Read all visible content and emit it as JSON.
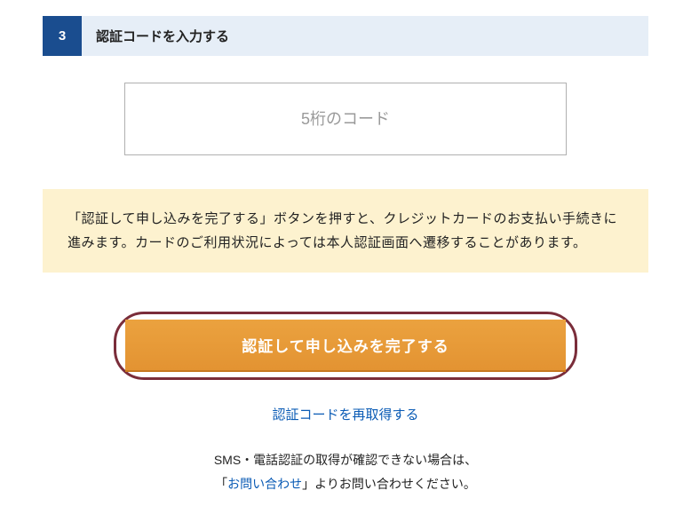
{
  "step": {
    "number": "3",
    "title": "認証コードを入力する"
  },
  "code_input": {
    "placeholder": "5桁のコード",
    "value": ""
  },
  "notice": "「認証して申し込みを完了する」ボタンを押すと、クレジットカードのお支払い手続きに進みます。カードのご利用状況によっては本人認証画面へ遷移することがあります。",
  "submit_button": {
    "label": "認証して申し込みを完了する"
  },
  "resend_link": {
    "label": "認証コードを再取得する"
  },
  "help": {
    "line1": "SMS・電話認証の取得が確認できない場合は、",
    "line2_prefix": "「",
    "contact_label": "お問い合わせ",
    "line2_suffix": "」よりお問い合わせください。"
  }
}
